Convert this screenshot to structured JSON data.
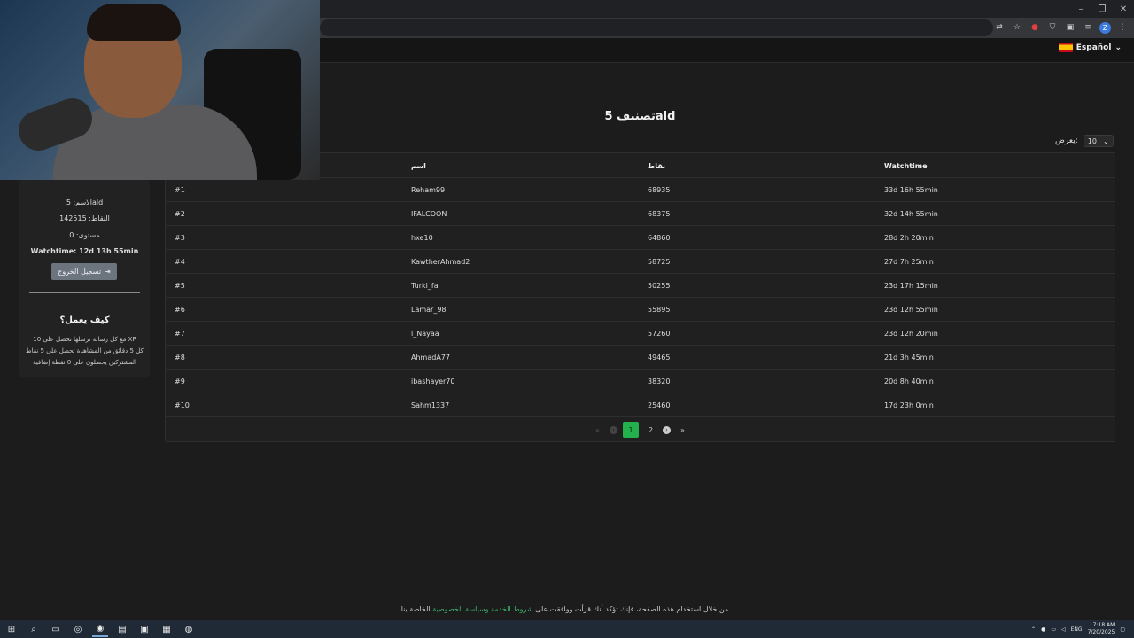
{
  "browser": {
    "window_controls": [
      "–",
      "❐",
      "✕"
    ],
    "toolbar_icons": [
      "translate-icon",
      "star-icon",
      "red-extension-icon",
      "shield-icon",
      "puzzle-icon",
      "media-icon",
      "profile-icon",
      "menu-icon"
    ],
    "profile_initial": "Z"
  },
  "header": {
    "language_label": "Español",
    "language_chevron": "⌄"
  },
  "page": {
    "title": "تصنيف 5ald",
    "show_label": "يعرض:",
    "show_value": "10"
  },
  "table": {
    "headers": [
      "",
      "اسم",
      "نقاط",
      "Watchtime"
    ],
    "rows": [
      [
        "#1",
        "Reham99",
        "68935",
        "33d 16h 55min"
      ],
      [
        "#2",
        "IFALCOON",
        "68375",
        "32d 14h 55min"
      ],
      [
        "#3",
        "hxe10",
        "64860",
        "28d 2h 20min"
      ],
      [
        "#4",
        "KawtherAhmad2",
        "58725",
        "27d 7h 25min"
      ],
      [
        "#5",
        "Turki_fa",
        "50255",
        "23d 17h 15min"
      ],
      [
        "#6",
        "Lamar_98",
        "55895",
        "23d 12h 55min"
      ],
      [
        "#7",
        "l_Nayaa",
        "57260",
        "23d 12h 20min"
      ],
      [
        "#8",
        "AhmadA77",
        "49465",
        "21d 3h 45min"
      ],
      [
        "#9",
        "ibashayer70",
        "38320",
        "20d 8h 40min"
      ],
      [
        "#10",
        "Sahm1337",
        "25460",
        "17d 23h 0min"
      ]
    ]
  },
  "pagination": {
    "first": "«",
    "prev": "‹",
    "pages": [
      "1",
      "2"
    ],
    "current": "1",
    "next": "›",
    "last": "»"
  },
  "sidebar": {
    "name": "الاسم: 5ald",
    "points": "النقاط: 142515",
    "level": "مستوى: 0",
    "watchtime": "Watchtime: 12d 13h 55min",
    "logout_label": "تسجيل الخروج",
    "how_title": "كيف يعمل؟",
    "how_lines": [
      "مع كل رسالة ترسلها تحصل على 10 XP",
      "كل 5 دقائق من المشاهدة تحصل على 5 نقاط",
      "المشتركين يحصلون على 0 نقطة إضافية"
    ]
  },
  "footer": {
    "prefix": "من خلال استخدام هذه الصفحة، فإنك تؤكد أنك قرأت ووافقت على",
    "link": "شروط الخدمة وسياسة الخصوصية",
    "suffix": "الخاصة بنا ."
  },
  "taskbar": {
    "language": "ENG",
    "time": "7:18 AM",
    "date": "7/20/2025"
  }
}
